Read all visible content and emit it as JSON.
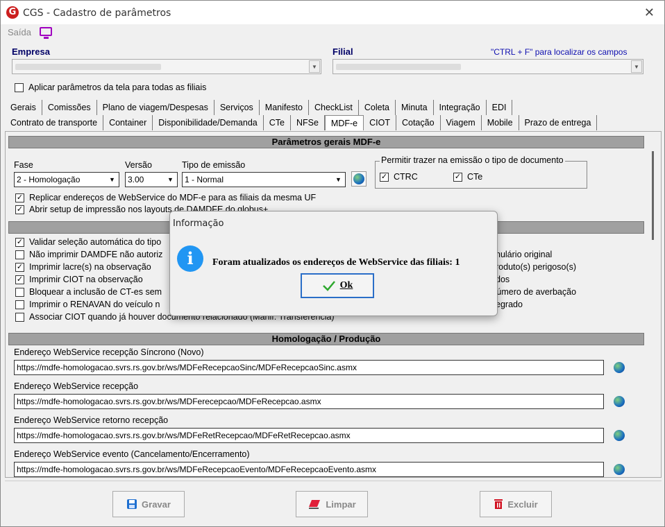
{
  "window": {
    "title": "CGS - Cadastro de parâmetros",
    "close": "✕"
  },
  "toolbar": {
    "saida": "Saída"
  },
  "header": {
    "empresa_label": "Empresa",
    "filial_label": "Filial",
    "hint": "\"CTRL + F\" para localizar os campos",
    "apply_all": "Aplicar parâmetros da tela para todas as filiais"
  },
  "tabs_row1": [
    "Gerais",
    "Comissões",
    "Plano de viagem/Despesas",
    "Serviços",
    "Manifesto",
    "CheckList",
    "Coleta",
    "Minuta",
    "Integração",
    "EDI"
  ],
  "tabs_row2": [
    "Contrato de transporte",
    "Container",
    "Disponibilidade/Demanda",
    "CTe",
    "NFSe",
    "MDF-e",
    "CIOT",
    "Cotação",
    "Viagem",
    "Mobile",
    "Prazo de entrega"
  ],
  "active_tab": "MDF-e",
  "section1": {
    "title": "Parâmetros gerais MDF-e",
    "fase_label": "Fase",
    "fase_value": "2 - Homologação",
    "versao_label": "Versão",
    "versao_value": "3.00",
    "tipo_label": "Tipo de emissão",
    "tipo_value": "1 - Normal",
    "group_label": "Permitir trazer na emissão o tipo de documento",
    "ctrc": "CTRC",
    "cte": "CTe",
    "replicar": "Replicar endereços de WebService do MDF-e para as filiais da mesma UF",
    "abrir": "Abrir setup de impressão nos layouts de DAMDFE do globus+"
  },
  "section2": {
    "items_left": [
      {
        "label": "Validar seleção automática do tipo",
        "checked": true
      },
      {
        "label": "Não imprimir DAMDFE não autoriz",
        "checked": false
      },
      {
        "label": "Imprimir lacre(s) na observação",
        "checked": true
      },
      {
        "label": "Imprimir CIOT na observação",
        "checked": true
      },
      {
        "label": "Bloquear a inclusão de CT-es sem",
        "checked": false
      },
      {
        "label": "Imprimir o RENAVAN do veículo n",
        "checked": false
      },
      {
        "label": "Associar CIOT quando já houver documento relacionado (Manif. Transferência)",
        "checked": false
      }
    ],
    "items_right": [
      "nulário original",
      "roduto(s) perigoso(s)",
      "dos",
      "e número de averbação",
      "egrado"
    ]
  },
  "section3": {
    "title": "Homologação / Produção",
    "fields": [
      {
        "label": "Endereço WebService recepção Síncrono (Novo)",
        "value": "https://mdfe-homologacao.svrs.rs.gov.br/ws/MDFeRecepcaoSinc/MDFeRecepcaoSinc.asmx"
      },
      {
        "label": "Endereço WebService recepção",
        "value": "https://mdfe-homologacao.svrs.rs.gov.br/ws/MDFerecepcao/MDFeRecepcao.asmx"
      },
      {
        "label": "Endereço WebService retorno recepção",
        "value": "https://mdfe-homologacao.svrs.rs.gov.br/ws/MDFeRetRecepcao/MDFeRetRecepcao.asmx"
      },
      {
        "label": "Endereço WebService evento (Cancelamento/Encerramento)",
        "value": "https://mdfe-homologacao.svrs.rs.gov.br/ws/MDFeRecepcaoEvento/MDFeRecepcaoEvento.asmx"
      }
    ]
  },
  "buttons": {
    "gravar": "Gravar",
    "limpar": "Limpar",
    "excluir": "Excluir"
  },
  "dialog": {
    "title": "Informação",
    "message": "Foram atualizados os endereços de WebService das filiais: 1",
    "ok": "Ok"
  }
}
